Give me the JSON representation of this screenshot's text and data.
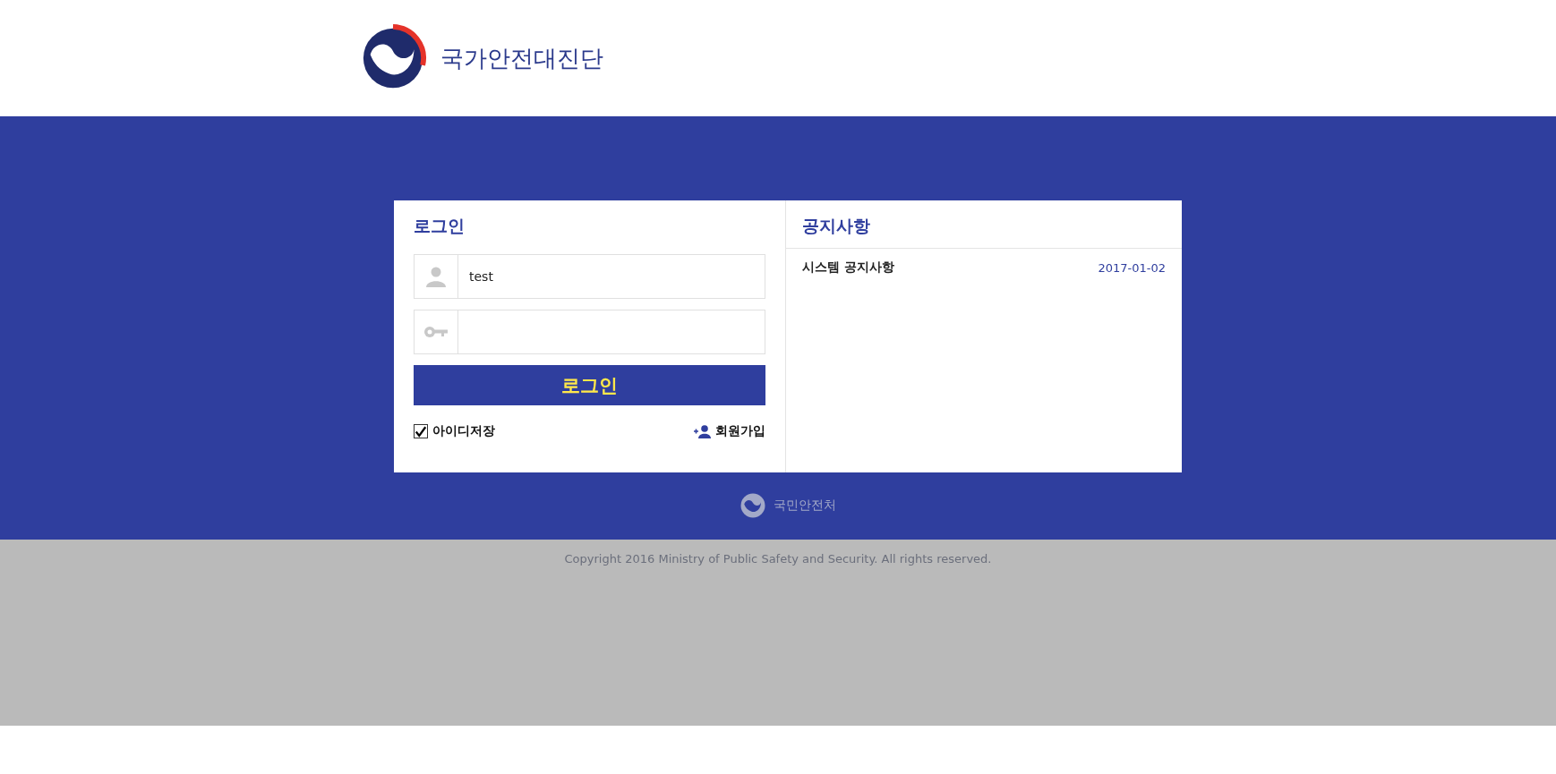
{
  "header": {
    "title": "국가안전대진단"
  },
  "login": {
    "title": "로그인",
    "username": {
      "value": "test"
    },
    "submit": "로그인",
    "remember": {
      "label": "아이디저장",
      "checked": true
    },
    "signup": "회원가입"
  },
  "notices": {
    "title": "공지사항",
    "items": [
      {
        "title": "시스템 공지사항",
        "date": "2017-01-02"
      }
    ]
  },
  "footer": {
    "org": "국민안전처",
    "copyright": "Copyright 2016 Ministry of Public Safety and Security. All rights reserved."
  }
}
